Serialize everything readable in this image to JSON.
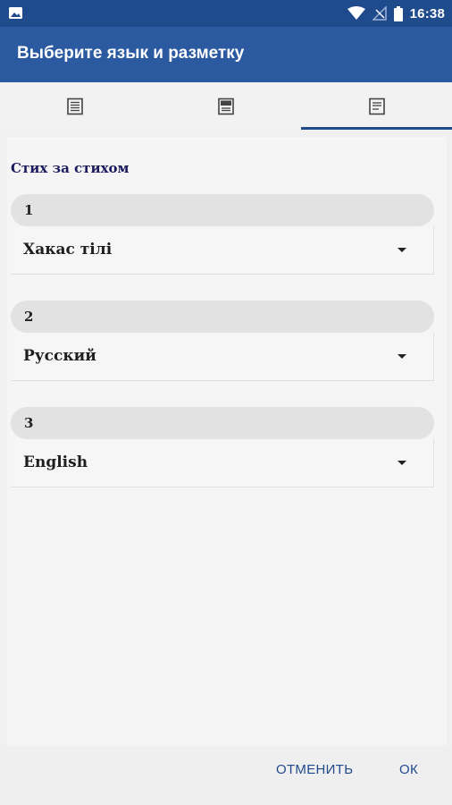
{
  "status_bar": {
    "time": "16:38",
    "icons": [
      "image-icon",
      "wifi-icon",
      "signal-icon",
      "battery-icon"
    ]
  },
  "app_bar": {
    "title": "Выберите язык и разметку"
  },
  "tabs": [
    {
      "icon": "single-page-icon",
      "active": false
    },
    {
      "icon": "split-page-icon",
      "active": false
    },
    {
      "icon": "verse-by-verse-icon",
      "active": true
    }
  ],
  "content": {
    "section_title": "Стих за стихом",
    "slots": [
      {
        "number": "1",
        "language": "Хакас тілі"
      },
      {
        "number": "2",
        "language": "Русский"
      },
      {
        "number": "3",
        "language": "English"
      }
    ]
  },
  "actions": {
    "cancel_label": "ОТМЕНИТЬ",
    "ok_label": "ОК"
  },
  "colors": {
    "primary": "#2c5aa0",
    "primary_dark": "#1f4a8c",
    "accent_text": "#1a1a5e"
  }
}
